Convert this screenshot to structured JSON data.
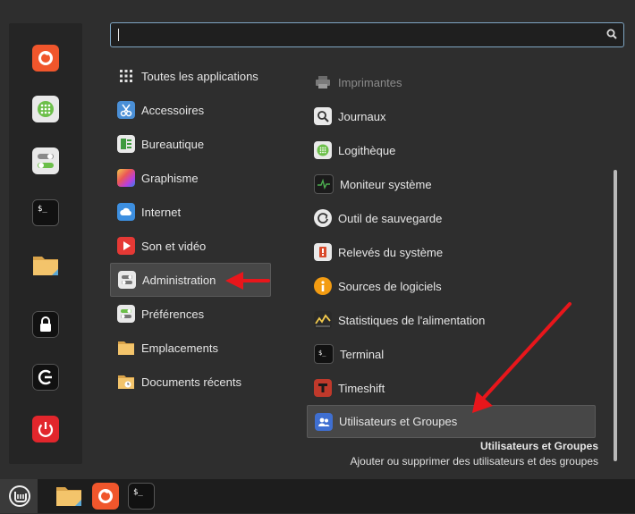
{
  "search": {
    "value": "",
    "placeholder": ""
  },
  "favorites": [
    {
      "name": "Firefox",
      "icon": "firefox-icon"
    },
    {
      "name": "Logithèque",
      "icon": "software-manager-icon"
    },
    {
      "name": "Paramètres",
      "icon": "settings-toggle-icon"
    },
    {
      "name": "Terminal",
      "icon": "terminal-icon"
    },
    {
      "name": "Fichiers",
      "icon": "folder-icon"
    },
    {
      "name": "Verrouiller",
      "icon": "lock-icon"
    },
    {
      "name": "Déconnexion",
      "icon": "logout-icon"
    },
    {
      "name": "Éteindre",
      "icon": "power-icon"
    }
  ],
  "categories": [
    {
      "label": "Toutes les applications",
      "icon": "grid-icon"
    },
    {
      "label": "Accessoires",
      "icon": "scissors-icon"
    },
    {
      "label": "Bureautique",
      "icon": "office-icon"
    },
    {
      "label": "Graphisme",
      "icon": "graphics-icon"
    },
    {
      "label": "Internet",
      "icon": "cloud-icon"
    },
    {
      "label": "Son et vidéo",
      "icon": "play-icon"
    },
    {
      "label": "Administration",
      "icon": "admin-toggle-icon",
      "selected": true
    },
    {
      "label": "Préférences",
      "icon": "preferences-icon"
    },
    {
      "label": "Emplacements",
      "icon": "folder-icon"
    },
    {
      "label": "Documents récents",
      "icon": "recent-folder-icon"
    }
  ],
  "apps": [
    {
      "label": "Imprimantes",
      "icon": "printer-icon",
      "dimmed": true
    },
    {
      "label": "Journaux",
      "icon": "logs-icon"
    },
    {
      "label": "Logithèque",
      "icon": "software-manager-icon"
    },
    {
      "label": "Moniteur système",
      "icon": "system-monitor-icon"
    },
    {
      "label": "Outil de sauvegarde",
      "icon": "backup-icon"
    },
    {
      "label": "Relevés du système",
      "icon": "system-reports-icon"
    },
    {
      "label": "Sources de logiciels",
      "icon": "software-sources-icon"
    },
    {
      "label": "Statistiques de l'alimentation",
      "icon": "power-stats-icon"
    },
    {
      "label": "Terminal",
      "icon": "terminal-icon"
    },
    {
      "label": "Timeshift",
      "icon": "timeshift-icon"
    },
    {
      "label": "Utilisateurs et Groupes",
      "icon": "users-groups-icon",
      "highlighted": true
    }
  ],
  "description": {
    "title": "Utilisateurs et Groupes",
    "text": "Ajouter ou supprimer des utilisateurs et des groupes"
  },
  "taskbar": [
    {
      "icon": "mint-menu-icon"
    },
    {
      "icon": "folder-icon"
    },
    {
      "icon": "firefox-icon"
    },
    {
      "icon": "terminal-icon"
    }
  ],
  "colors": {
    "accent_border": "#7fa6c3",
    "annotation_arrow": "#e8161b"
  }
}
